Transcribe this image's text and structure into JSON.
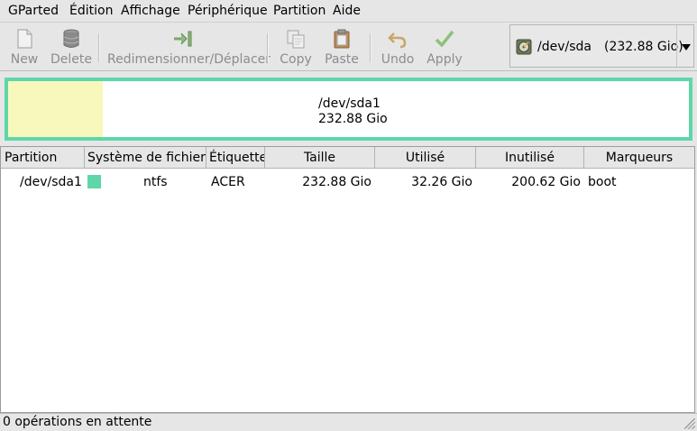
{
  "menu": [
    {
      "label": "GParted"
    },
    {
      "label": "Édition"
    },
    {
      "label": "Affichage"
    },
    {
      "label": "Périphérique"
    },
    {
      "label": "Partition"
    },
    {
      "label": "Aide"
    }
  ],
  "toolbar": {
    "new": "New",
    "delete": "Delete",
    "resize": "Redimensionner/Déplacer",
    "copy": "Copy",
    "paste": "Paste",
    "undo": "Undo",
    "apply": "Apply",
    "icons": {
      "new": "new-document-icon",
      "delete": "trash-icon",
      "resize": "resize-move-icon",
      "copy": "copy-icon",
      "paste": "paste-icon",
      "undo": "undo-icon",
      "apply": "apply-checkmark-icon"
    }
  },
  "device": {
    "name": "/dev/sda",
    "size": "(232.88 Gio)",
    "icon": "hard-disk-icon"
  },
  "disk_map": {
    "partition": "/dev/sda1",
    "size": "232.88 Gio",
    "used_fraction": 0.1385,
    "border_color": "#5fd6aa",
    "used_color": "#f8f8bc"
  },
  "table": {
    "columns": [
      "Partition",
      "Système de fichiers",
      "Étiquette",
      "Taille",
      "Utilisé",
      "Inutilisé",
      "Marqueurs"
    ],
    "rows": [
      {
        "partition": "/dev/sda1",
        "filesystem": "ntfs",
        "fs_color": "#5fd6aa",
        "label": "ACER",
        "size": "232.88 Gio",
        "used": "32.26 Gio",
        "unused": "200.62 Gio",
        "flags": "boot"
      }
    ]
  },
  "status": {
    "text": "0 opérations en attente"
  }
}
